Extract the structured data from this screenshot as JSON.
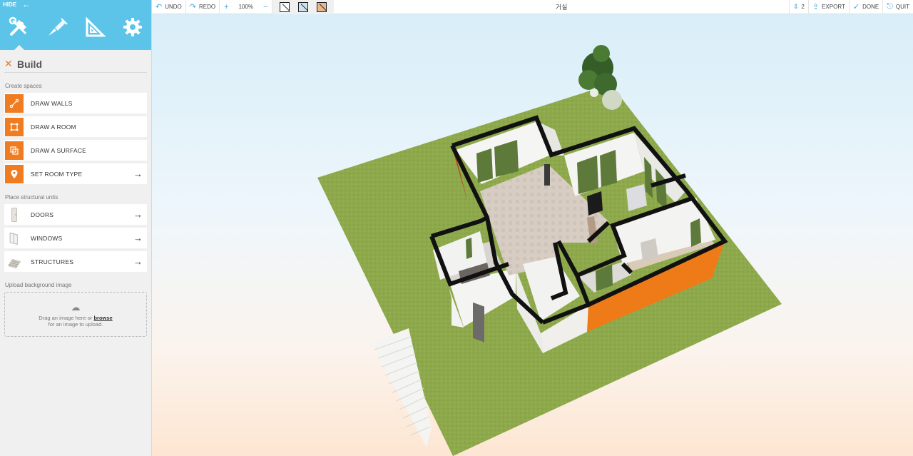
{
  "sidebar": {
    "hide_label": "HIDE",
    "mode_tabs": [
      {
        "name": "build",
        "icon": "build-tools-icon"
      },
      {
        "name": "decorate",
        "icon": "paint-brush-icon"
      },
      {
        "name": "measure",
        "icon": "set-square-icon"
      },
      {
        "name": "settings",
        "icon": "gear-icon"
      }
    ],
    "panel_title": "Build",
    "create_spaces_label": "Create spaces",
    "create_spaces": [
      {
        "label": "DRAW WALLS",
        "icon": "draw-walls-icon"
      },
      {
        "label": "DRAW A ROOM",
        "icon": "draw-room-icon"
      },
      {
        "label": "DRAW A SURFACE",
        "icon": "draw-surface-icon"
      },
      {
        "label": "SET ROOM TYPE",
        "icon": "location-pin-icon"
      }
    ],
    "structural_label": "Place structural units",
    "structural": [
      {
        "label": "DOORS",
        "icon": "door-icon"
      },
      {
        "label": "WINDOWS",
        "icon": "window-icon"
      },
      {
        "label": "STRUCTURES",
        "icon": "stairs-icon"
      }
    ],
    "upload_label": "Upload background image",
    "upload_text_1": "Drag an image here or",
    "upload_browse": "browse",
    "upload_text_2": "for an image to upload."
  },
  "toolbar": {
    "undo": "UNDO",
    "redo": "REDO",
    "zoom": "100%",
    "room_name": "거실",
    "floor_count": "2",
    "export": "EXPORT",
    "done": "DONE",
    "quit": "QUIT"
  },
  "colors": {
    "accent_blue": "#5bc4e8",
    "accent_orange": "#f07c22",
    "grass": "#8ba848",
    "wall_orange": "#ee7b18"
  }
}
